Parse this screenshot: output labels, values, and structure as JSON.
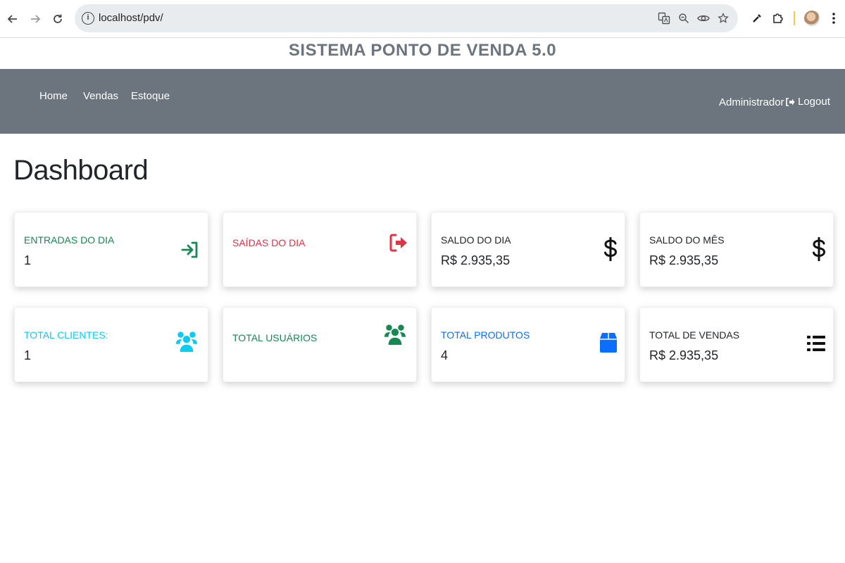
{
  "browser": {
    "url": "localhost/pdv/",
    "info_symbol": "i"
  },
  "header": {
    "title": "SISTEMA PONTO DE VENDA 5.0"
  },
  "navbar": {
    "links": [
      "Home",
      "Vendas",
      "Estoque"
    ],
    "user": "Administrador",
    "logout": "Logout"
  },
  "main": {
    "heading": "Dashboard",
    "cards": [
      {
        "label": "ENTRADAS DO DIA",
        "value": "1",
        "color": "#198754",
        "icon": "sign-in-icon"
      },
      {
        "label": "SAÍDAS DO DIA",
        "value": "",
        "color": "#dc3545",
        "icon": "sign-out-icon"
      },
      {
        "label": "SALDO DO DIA",
        "value": "R$ 2.935,35",
        "color": "#212529",
        "icon": "dollar-icon"
      },
      {
        "label": "SALDO DO MÊS",
        "value": "R$ 2.935,35",
        "color": "#212529",
        "icon": "dollar-icon"
      },
      {
        "label": "TOTAL CLIENTES:",
        "value": "1",
        "color": "#0dcaf0",
        "icon": "users-icon"
      },
      {
        "label": "TOTAL USUÁRIOS",
        "value": "",
        "color": "#198754",
        "icon": "users-icon"
      },
      {
        "label": "TOTAL PRODUTOS",
        "value": "4",
        "color": "#0d6efd",
        "icon": "box-icon"
      },
      {
        "label": "TOTAL DE VENDAS",
        "value": "R$ 2.935,35",
        "color": "#212529",
        "icon": "list-icon"
      }
    ]
  }
}
